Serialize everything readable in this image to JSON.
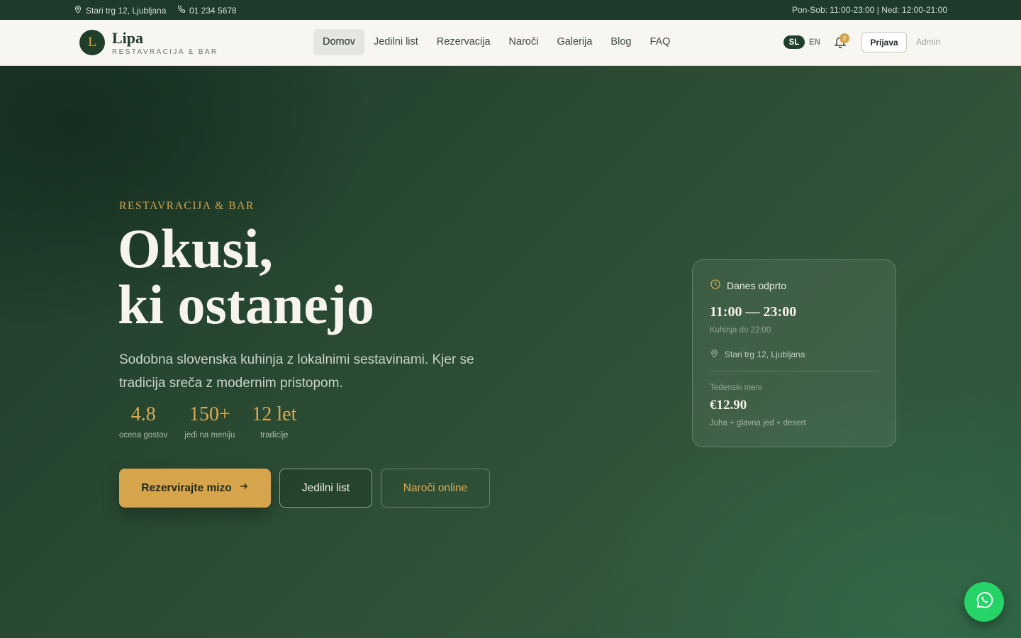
{
  "topbar": {
    "address": "Stari trg 12, Ljubljana",
    "phone": "01 234 5678",
    "hours": "Pon-Sob: 11:00-23:00 | Ned: 12:00-21:00"
  },
  "brand": {
    "initial": "L",
    "name": "Lipa",
    "tagline": "RESTAVRACIJA & BAR"
  },
  "nav": {
    "items": [
      {
        "label": "Domov",
        "active": true
      },
      {
        "label": "Jedilni list"
      },
      {
        "label": "Rezervacija"
      },
      {
        "label": "Naroči"
      },
      {
        "label": "Galerija"
      },
      {
        "label": "Blog"
      },
      {
        "label": "FAQ"
      }
    ]
  },
  "header": {
    "lang_active": "SL",
    "lang_other": "EN",
    "notification_count": "2",
    "login_label": "Prijava",
    "admin_label": "Admin"
  },
  "hero": {
    "eyebrow": "RESTAVRACIJA & BAR",
    "title_line1": "Okusi,",
    "title_line2": "ki ostanejo",
    "subtitle": "Sodobna slovenska kuhinja z lokalnimi sestavinami. Kjer se tradicija sreča z modernim pristopom.",
    "stats": [
      {
        "value": "4.8",
        "label": "ocena gostov"
      },
      {
        "value": "150+",
        "label": "jedi na meniju"
      },
      {
        "value": "12 let",
        "label": "tradicije"
      }
    ],
    "cta_reserve": "Rezervirajte mizo",
    "cta_menu": "Jedilni list",
    "cta_order": "Naroči online"
  },
  "info_card": {
    "open_label": "Danes odprto",
    "hours": "11:00 — 23:00",
    "kitchen": "Kuhinja do 22:00",
    "address": "Stari trg 12, Ljubljana",
    "weekly_label": "Tedenski meni",
    "weekly_price": "€12.90",
    "weekly_desc": "Juha + glavna jed + desert"
  },
  "colors": {
    "dark_green": "#1f3f2b",
    "accent_gold": "#d6a44b",
    "whatsapp": "#25d366"
  },
  "icons": [
    "map-pin-icon",
    "phone-icon",
    "bell-icon",
    "arrow-right-icon",
    "clock-icon",
    "whatsapp-icon"
  ]
}
